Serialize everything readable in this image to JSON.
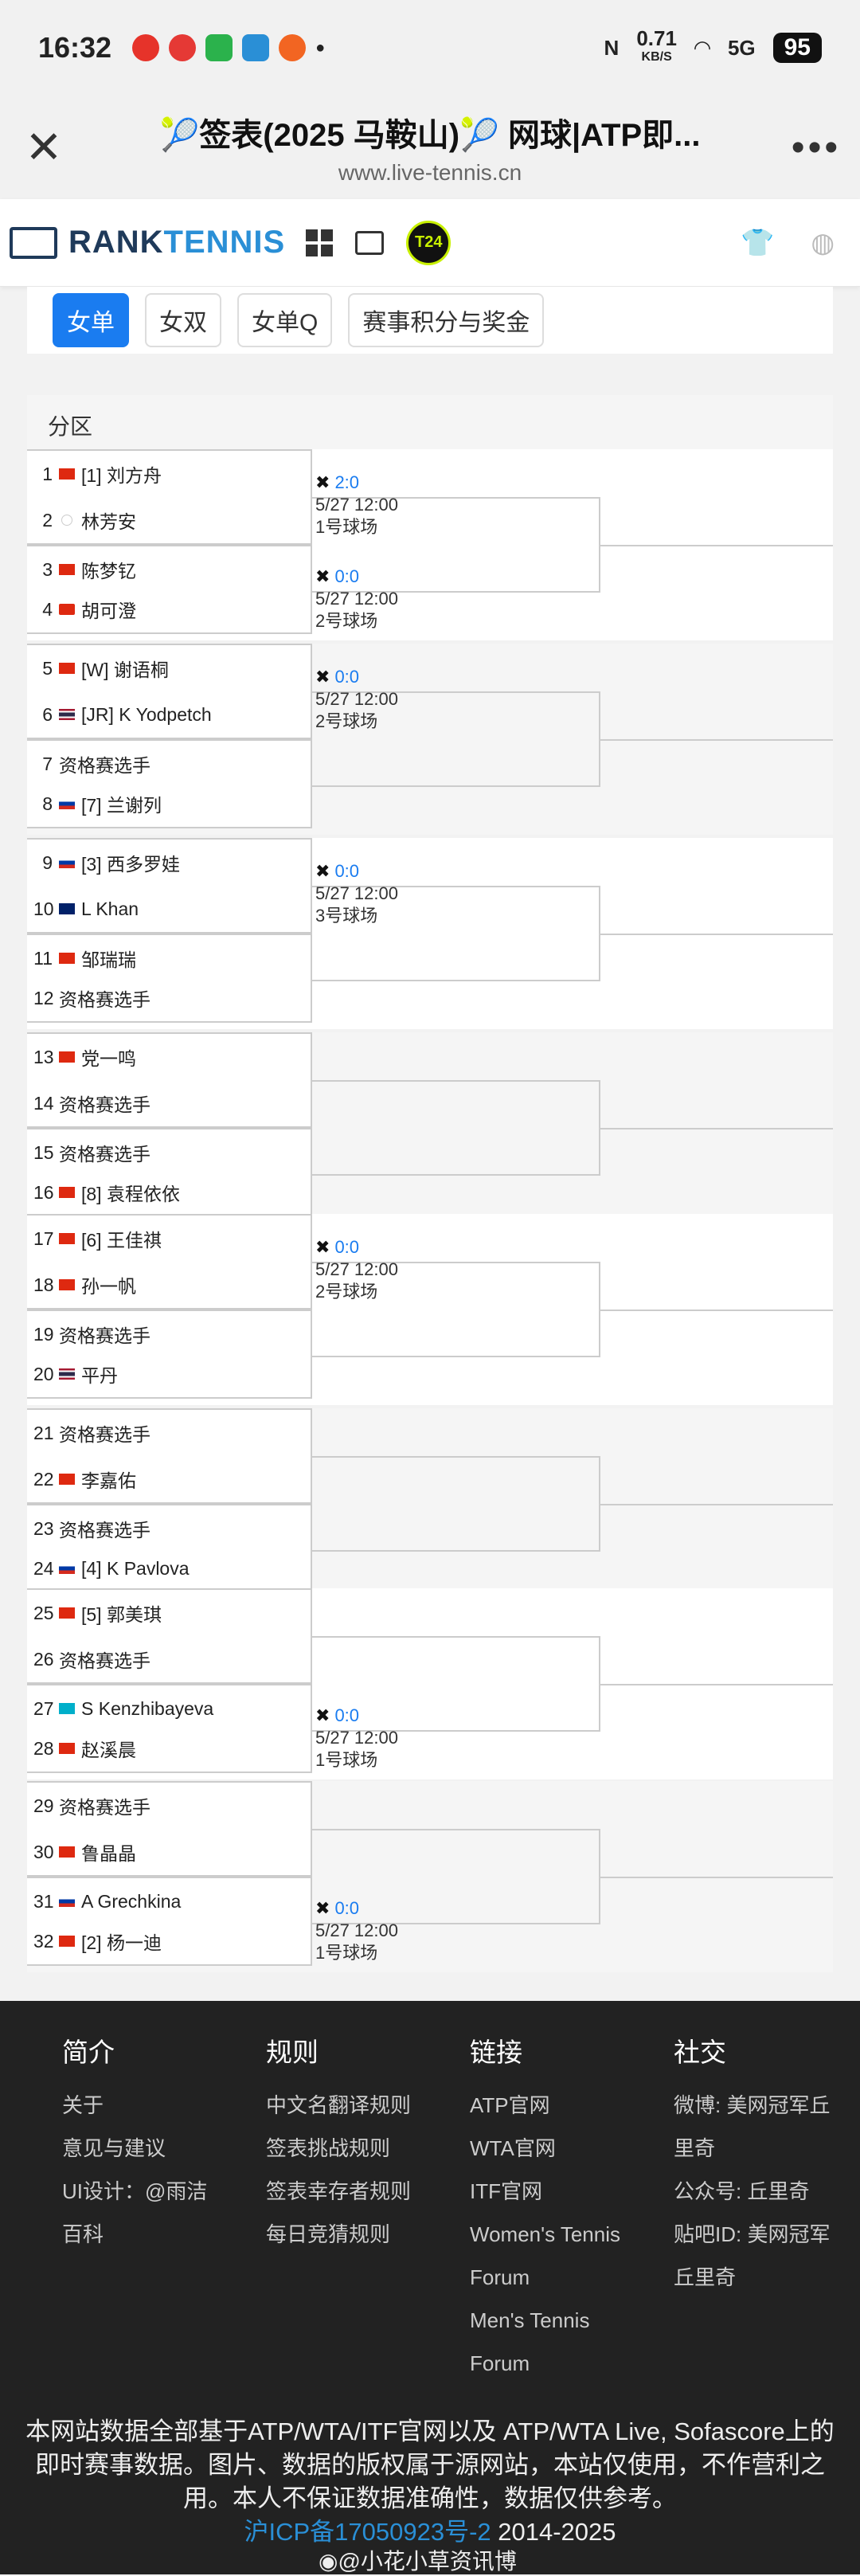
{
  "status": {
    "time": "16:32",
    "net_speed": "0.71",
    "net_unit": "KB/S",
    "battery": "95",
    "signal": "5G"
  },
  "title": {
    "text": "🎾签表(2025 马鞍山)🎾 网球|ATP即...",
    "url": "www.live-tennis.cn"
  },
  "brand": {
    "name_a": "RANK",
    "name_b": "TENNIS",
    "badge": "T24"
  },
  "tabs": [
    "女单",
    "女双",
    "女单Q",
    "赛事积分与奖金"
  ],
  "section": "分区",
  "players": [
    {
      "n": "1",
      "flag": "cn",
      "name": "[1] 刘方舟"
    },
    {
      "n": "2",
      "flag": "un",
      "name": "林芳安"
    },
    {
      "n": "3",
      "flag": "cn",
      "name": "陈梦钇"
    },
    {
      "n": "4",
      "flag": "hk",
      "name": "胡可澄"
    },
    {
      "n": "5",
      "flag": "cn",
      "name": "[W] 谢语桐"
    },
    {
      "n": "6",
      "flag": "th",
      "name": "[JR] K Yodpetch"
    },
    {
      "n": "7",
      "flag": "none",
      "name": "资格赛选手"
    },
    {
      "n": "8",
      "flag": "ru",
      "name": "[7] 兰谢列"
    },
    {
      "n": "9",
      "flag": "ru",
      "name": "[3] 西多罗娃"
    },
    {
      "n": "10",
      "flag": "au",
      "name": "L Khan"
    },
    {
      "n": "11",
      "flag": "cn",
      "name": "邹瑞瑞"
    },
    {
      "n": "12",
      "flag": "none",
      "name": "资格赛选手"
    },
    {
      "n": "13",
      "flag": "cn",
      "name": "党一鸣"
    },
    {
      "n": "14",
      "flag": "none",
      "name": "资格赛选手"
    },
    {
      "n": "15",
      "flag": "none",
      "name": "资格赛选手"
    },
    {
      "n": "16",
      "flag": "cn",
      "name": "[8] 袁程依依"
    },
    {
      "n": "17",
      "flag": "cn",
      "name": "[6] 王佳祺"
    },
    {
      "n": "18",
      "flag": "cn",
      "name": "孙一帆"
    },
    {
      "n": "19",
      "flag": "none",
      "name": "资格赛选手"
    },
    {
      "n": "20",
      "flag": "th",
      "name": "平丹"
    },
    {
      "n": "21",
      "flag": "none",
      "name": "资格赛选手"
    },
    {
      "n": "22",
      "flag": "cn",
      "name": "李嘉佑"
    },
    {
      "n": "23",
      "flag": "none",
      "name": "资格赛选手"
    },
    {
      "n": "24",
      "flag": "ru",
      "name": "[4] K Pavlova"
    },
    {
      "n": "25",
      "flag": "cn",
      "name": "[5] 郭美琪"
    },
    {
      "n": "26",
      "flag": "none",
      "name": "资格赛选手"
    },
    {
      "n": "27",
      "flag": "kz",
      "name": "S Kenzhibayeva"
    },
    {
      "n": "28",
      "flag": "cn",
      "name": "赵溪晨"
    },
    {
      "n": "29",
      "flag": "none",
      "name": "资格赛选手"
    },
    {
      "n": "30",
      "flag": "cn",
      "name": "鲁晶晶"
    },
    {
      "n": "31",
      "flag": "ru",
      "name": "A Grechkina"
    },
    {
      "n": "32",
      "flag": "cn",
      "name": "[2] 杨一迪"
    }
  ],
  "matches": [
    {
      "pair": 0,
      "score": "2:0",
      "time": "5/27 12:00",
      "court": "1号球场"
    },
    {
      "pair": 1,
      "score": "0:0",
      "time": "5/27 12:00",
      "court": "2号球场"
    },
    {
      "pair": 2,
      "score": "0:0",
      "time": "5/27 12:00",
      "court": "2号球场"
    },
    {
      "pair": 4,
      "score": "0:0",
      "time": "5/27 12:00",
      "court": "3号球场"
    },
    {
      "pair": 8,
      "score": "0:0",
      "time": "5/27 12:00",
      "court": "2号球场"
    },
    {
      "pair": 13,
      "score": "0:0",
      "time": "5/27 12:00",
      "court": "1号球场"
    },
    {
      "pair": 15,
      "score": "0:0",
      "time": "5/27 12:00",
      "court": "1号球场"
    }
  ],
  "footer": {
    "cols": [
      {
        "title": "简介",
        "links": [
          "关于",
          "意见与建议",
          "UI设计：@雨洁",
          "百科"
        ]
      },
      {
        "title": "规则",
        "links": [
          "中文名翻译规则",
          "签表挑战规则",
          "签表幸存者规则",
          "每日竞猜规则"
        ]
      },
      {
        "title": "链接",
        "links": [
          "ATP官网",
          "WTA官网",
          "ITF官网",
          "Women's Tennis",
          "Forum",
          "Men's Tennis",
          "Forum"
        ]
      },
      {
        "title": "社交",
        "links": [
          "微博: 美网冠军丘",
          "里奇",
          "公众号: 丘里奇",
          "贴吧ID: 美网冠军",
          "丘里奇"
        ]
      }
    ],
    "note": "本网站数据全部基于ATP/WTA/ITF官网以及 ATP/WTA Live, Sofascore上的即时赛事数据。图片、数据的版权属于源网站，本站仅使用，不作营利之用。本人不保证数据准确性，数据仅供参考。",
    "icp": "沪ICP备17050923号-2",
    "years": "2014-2025",
    "watermark": "@小花小草资讯博"
  }
}
